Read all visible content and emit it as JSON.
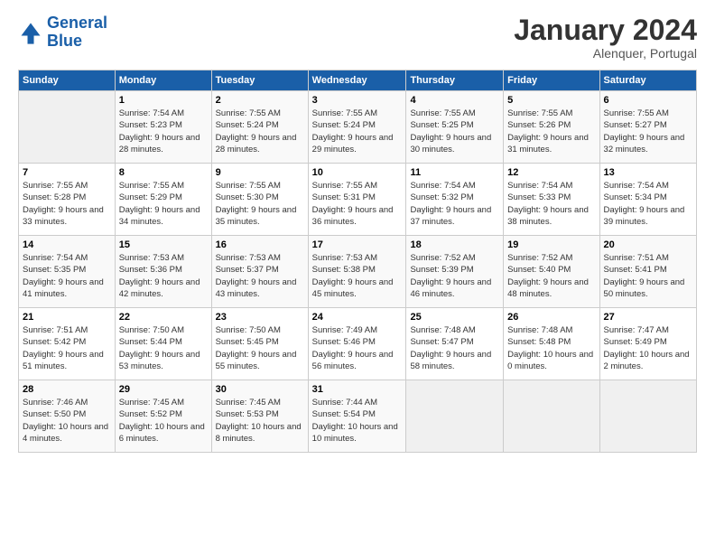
{
  "logo": {
    "line1": "General",
    "line2": "Blue"
  },
  "header": {
    "month": "January 2024",
    "location": "Alenquer, Portugal"
  },
  "weekdays": [
    "Sunday",
    "Monday",
    "Tuesday",
    "Wednesday",
    "Thursday",
    "Friday",
    "Saturday"
  ],
  "weeks": [
    [
      {
        "day": "",
        "sunrise": "",
        "sunset": "",
        "daylight": ""
      },
      {
        "day": "1",
        "sunrise": "Sunrise: 7:54 AM",
        "sunset": "Sunset: 5:23 PM",
        "daylight": "Daylight: 9 hours and 28 minutes."
      },
      {
        "day": "2",
        "sunrise": "Sunrise: 7:55 AM",
        "sunset": "Sunset: 5:24 PM",
        "daylight": "Daylight: 9 hours and 28 minutes."
      },
      {
        "day": "3",
        "sunrise": "Sunrise: 7:55 AM",
        "sunset": "Sunset: 5:24 PM",
        "daylight": "Daylight: 9 hours and 29 minutes."
      },
      {
        "day": "4",
        "sunrise": "Sunrise: 7:55 AM",
        "sunset": "Sunset: 5:25 PM",
        "daylight": "Daylight: 9 hours and 30 minutes."
      },
      {
        "day": "5",
        "sunrise": "Sunrise: 7:55 AM",
        "sunset": "Sunset: 5:26 PM",
        "daylight": "Daylight: 9 hours and 31 minutes."
      },
      {
        "day": "6",
        "sunrise": "Sunrise: 7:55 AM",
        "sunset": "Sunset: 5:27 PM",
        "daylight": "Daylight: 9 hours and 32 minutes."
      }
    ],
    [
      {
        "day": "7",
        "sunrise": "Sunrise: 7:55 AM",
        "sunset": "Sunset: 5:28 PM",
        "daylight": "Daylight: 9 hours and 33 minutes."
      },
      {
        "day": "8",
        "sunrise": "Sunrise: 7:55 AM",
        "sunset": "Sunset: 5:29 PM",
        "daylight": "Daylight: 9 hours and 34 minutes."
      },
      {
        "day": "9",
        "sunrise": "Sunrise: 7:55 AM",
        "sunset": "Sunset: 5:30 PM",
        "daylight": "Daylight: 9 hours and 35 minutes."
      },
      {
        "day": "10",
        "sunrise": "Sunrise: 7:55 AM",
        "sunset": "Sunset: 5:31 PM",
        "daylight": "Daylight: 9 hours and 36 minutes."
      },
      {
        "day": "11",
        "sunrise": "Sunrise: 7:54 AM",
        "sunset": "Sunset: 5:32 PM",
        "daylight": "Daylight: 9 hours and 37 minutes."
      },
      {
        "day": "12",
        "sunrise": "Sunrise: 7:54 AM",
        "sunset": "Sunset: 5:33 PM",
        "daylight": "Daylight: 9 hours and 38 minutes."
      },
      {
        "day": "13",
        "sunrise": "Sunrise: 7:54 AM",
        "sunset": "Sunset: 5:34 PM",
        "daylight": "Daylight: 9 hours and 39 minutes."
      }
    ],
    [
      {
        "day": "14",
        "sunrise": "Sunrise: 7:54 AM",
        "sunset": "Sunset: 5:35 PM",
        "daylight": "Daylight: 9 hours and 41 minutes."
      },
      {
        "day": "15",
        "sunrise": "Sunrise: 7:53 AM",
        "sunset": "Sunset: 5:36 PM",
        "daylight": "Daylight: 9 hours and 42 minutes."
      },
      {
        "day": "16",
        "sunrise": "Sunrise: 7:53 AM",
        "sunset": "Sunset: 5:37 PM",
        "daylight": "Daylight: 9 hours and 43 minutes."
      },
      {
        "day": "17",
        "sunrise": "Sunrise: 7:53 AM",
        "sunset": "Sunset: 5:38 PM",
        "daylight": "Daylight: 9 hours and 45 minutes."
      },
      {
        "day": "18",
        "sunrise": "Sunrise: 7:52 AM",
        "sunset": "Sunset: 5:39 PM",
        "daylight": "Daylight: 9 hours and 46 minutes."
      },
      {
        "day": "19",
        "sunrise": "Sunrise: 7:52 AM",
        "sunset": "Sunset: 5:40 PM",
        "daylight": "Daylight: 9 hours and 48 minutes."
      },
      {
        "day": "20",
        "sunrise": "Sunrise: 7:51 AM",
        "sunset": "Sunset: 5:41 PM",
        "daylight": "Daylight: 9 hours and 50 minutes."
      }
    ],
    [
      {
        "day": "21",
        "sunrise": "Sunrise: 7:51 AM",
        "sunset": "Sunset: 5:42 PM",
        "daylight": "Daylight: 9 hours and 51 minutes."
      },
      {
        "day": "22",
        "sunrise": "Sunrise: 7:50 AM",
        "sunset": "Sunset: 5:44 PM",
        "daylight": "Daylight: 9 hours and 53 minutes."
      },
      {
        "day": "23",
        "sunrise": "Sunrise: 7:50 AM",
        "sunset": "Sunset: 5:45 PM",
        "daylight": "Daylight: 9 hours and 55 minutes."
      },
      {
        "day": "24",
        "sunrise": "Sunrise: 7:49 AM",
        "sunset": "Sunset: 5:46 PM",
        "daylight": "Daylight: 9 hours and 56 minutes."
      },
      {
        "day": "25",
        "sunrise": "Sunrise: 7:48 AM",
        "sunset": "Sunset: 5:47 PM",
        "daylight": "Daylight: 9 hours and 58 minutes."
      },
      {
        "day": "26",
        "sunrise": "Sunrise: 7:48 AM",
        "sunset": "Sunset: 5:48 PM",
        "daylight": "Daylight: 10 hours and 0 minutes."
      },
      {
        "day": "27",
        "sunrise": "Sunrise: 7:47 AM",
        "sunset": "Sunset: 5:49 PM",
        "daylight": "Daylight: 10 hours and 2 minutes."
      }
    ],
    [
      {
        "day": "28",
        "sunrise": "Sunrise: 7:46 AM",
        "sunset": "Sunset: 5:50 PM",
        "daylight": "Daylight: 10 hours and 4 minutes."
      },
      {
        "day": "29",
        "sunrise": "Sunrise: 7:45 AM",
        "sunset": "Sunset: 5:52 PM",
        "daylight": "Daylight: 10 hours and 6 minutes."
      },
      {
        "day": "30",
        "sunrise": "Sunrise: 7:45 AM",
        "sunset": "Sunset: 5:53 PM",
        "daylight": "Daylight: 10 hours and 8 minutes."
      },
      {
        "day": "31",
        "sunrise": "Sunrise: 7:44 AM",
        "sunset": "Sunset: 5:54 PM",
        "daylight": "Daylight: 10 hours and 10 minutes."
      },
      {
        "day": "",
        "sunrise": "",
        "sunset": "",
        "daylight": ""
      },
      {
        "day": "",
        "sunrise": "",
        "sunset": "",
        "daylight": ""
      },
      {
        "day": "",
        "sunrise": "",
        "sunset": "",
        "daylight": ""
      }
    ]
  ]
}
